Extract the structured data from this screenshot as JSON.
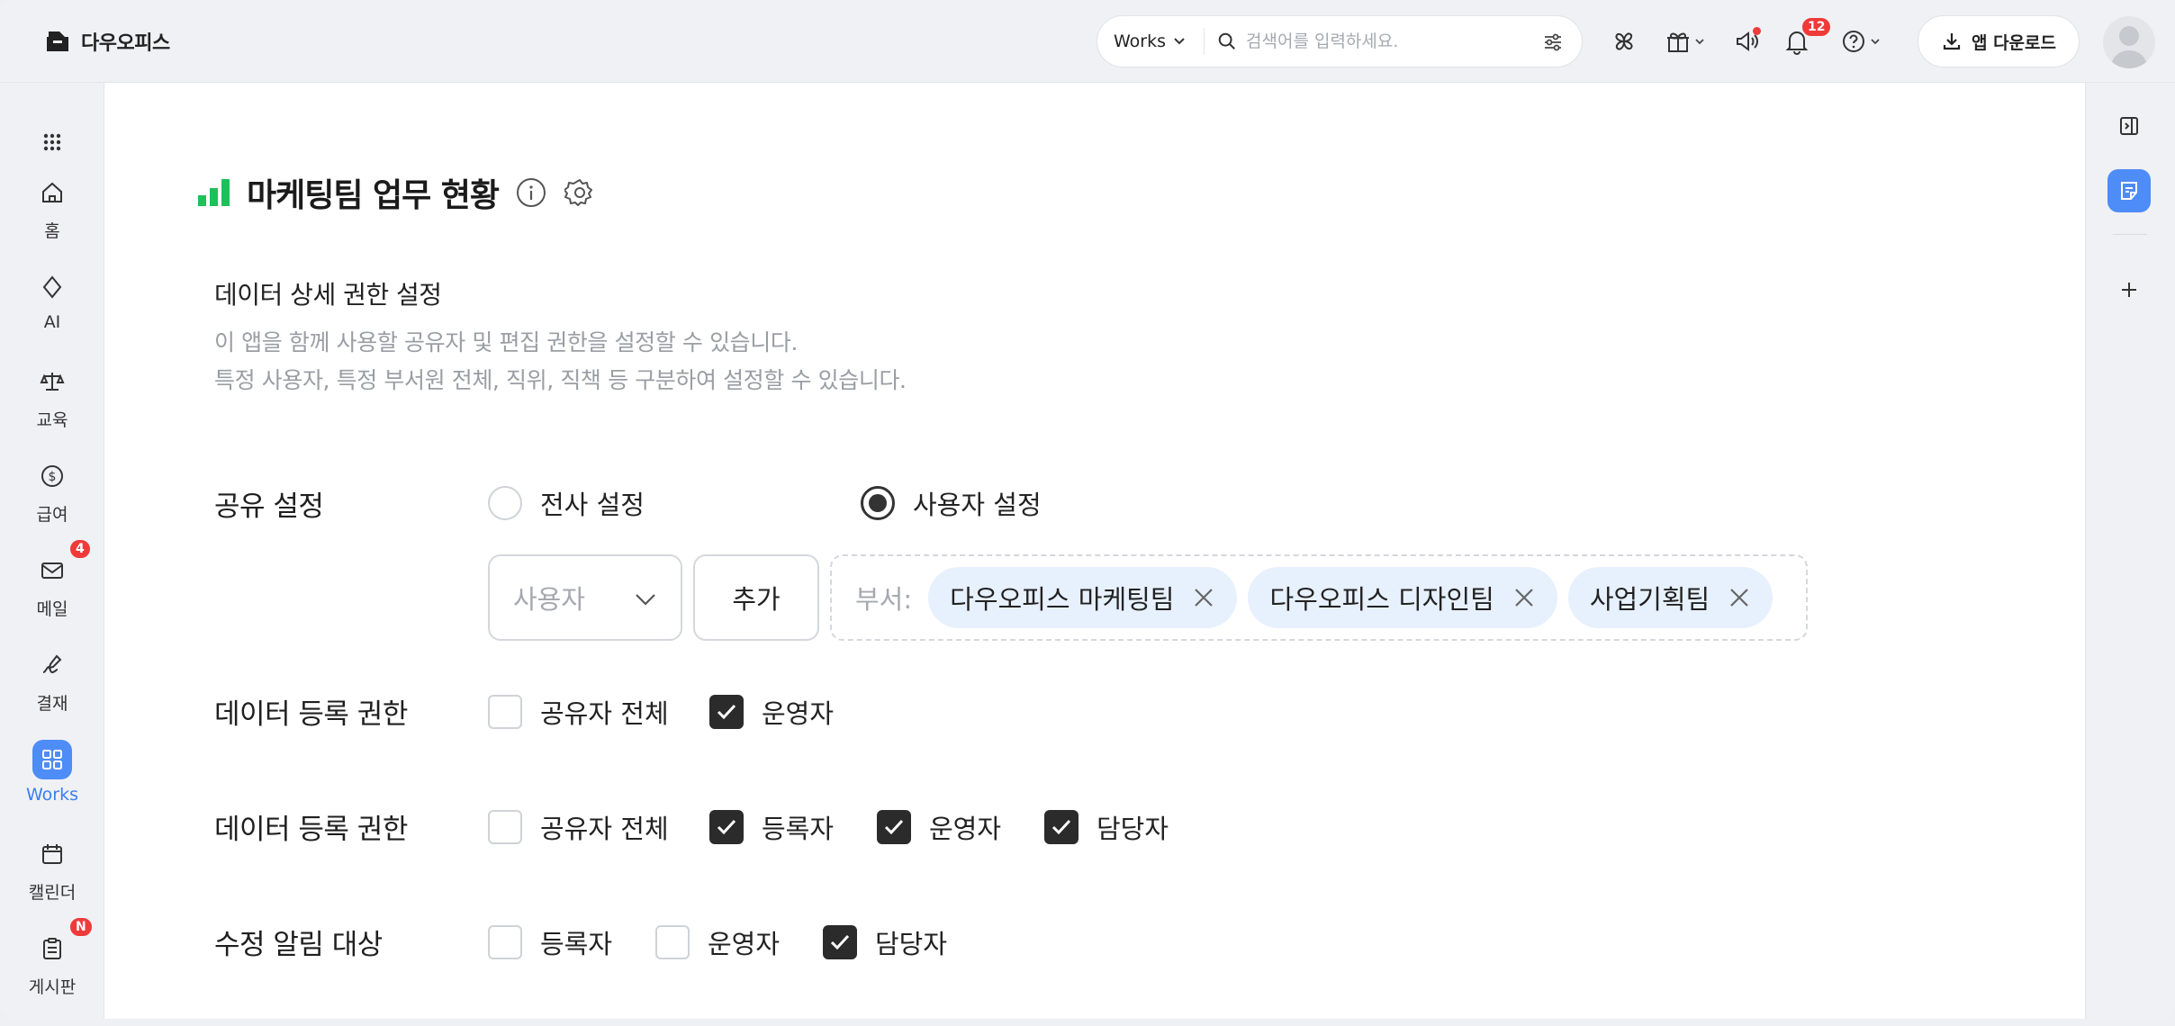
{
  "app": {
    "name": "다우오피스"
  },
  "search": {
    "scope": "Works",
    "placeholder": "검색어를 입력하세요."
  },
  "header": {
    "notification_count": "12",
    "download_label": "앱 다운로드"
  },
  "sidebar": {
    "items": [
      {
        "label": "홈",
        "icon": "home-icon"
      },
      {
        "label": "AI",
        "icon": "ai-icon"
      },
      {
        "label": "교육",
        "icon": "scale-icon"
      },
      {
        "label": "급여",
        "icon": "dollar-icon"
      },
      {
        "label": "메일",
        "icon": "mail-icon",
        "badge": "4"
      },
      {
        "label": "결재",
        "icon": "approval-icon"
      },
      {
        "label": "Works",
        "icon": "works-icon",
        "active": true
      },
      {
        "label": "캘린더",
        "icon": "calendar-icon"
      },
      {
        "label": "게시판",
        "icon": "board-icon",
        "badge": "N"
      }
    ]
  },
  "page": {
    "title": "마케팅팀 업무 현황"
  },
  "section": {
    "title": "데이터 상세 권한 설정",
    "desc_line1": "이 앱을 함께 사용할 공유자 및 편집 권한을 설정할 수 있습니다.",
    "desc_line2": "특정 사용자, 특정 부서원 전체, 직위, 직책 등 구분하여 설정할 수 있습니다."
  },
  "share": {
    "label": "공유 설정",
    "options": [
      {
        "label": "전사 설정",
        "selected": false
      },
      {
        "label": "사용자 설정",
        "selected": true
      }
    ],
    "select_value": "사용자",
    "add_label": "추가",
    "dept_label": "부서:",
    "chips": [
      "다우오피스 마케팅팀",
      "다우오피스 디자인팀",
      "사업기획팀"
    ]
  },
  "perm1": {
    "label": "데이터 등록 권한",
    "options": [
      {
        "label": "공유자 전체",
        "checked": false
      },
      {
        "label": "운영자",
        "checked": true
      }
    ]
  },
  "perm2": {
    "label": "데이터 등록 권한",
    "options": [
      {
        "label": "공유자 전체",
        "checked": false
      },
      {
        "label": "등록자",
        "checked": true
      },
      {
        "label": "운영자",
        "checked": true
      },
      {
        "label": "담당자",
        "checked": true
      }
    ]
  },
  "notify": {
    "label": "수정 알림 대상",
    "options": [
      {
        "label": "등록자",
        "checked": false
      },
      {
        "label": "운영자",
        "checked": false
      },
      {
        "label": "담당자",
        "checked": true
      }
    ]
  }
}
